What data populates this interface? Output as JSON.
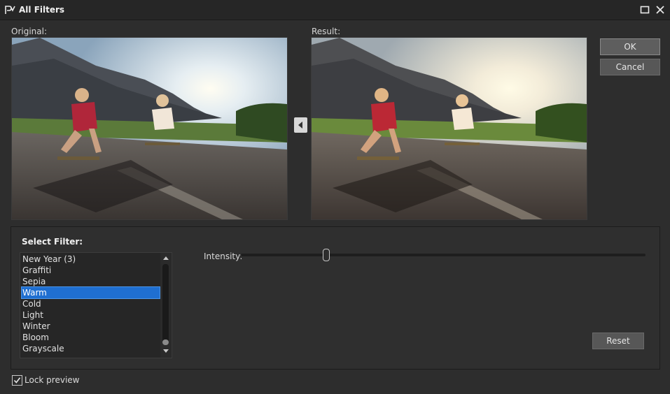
{
  "window": {
    "title": "All Filters",
    "icon": "app-logo-icon"
  },
  "preview": {
    "original_label": "Original:",
    "result_label": "Result:"
  },
  "buttons": {
    "ok": "OK",
    "cancel": "Cancel",
    "reset": "Reset"
  },
  "filter": {
    "select_label": "Select Filter:",
    "items": [
      "New Year (3)",
      "Graffiti",
      "Sepia",
      "Warm",
      "Cold",
      "Light",
      "Winter",
      "Bloom",
      "Grayscale"
    ],
    "selected": "Warm"
  },
  "intensity": {
    "label": "Intensity:",
    "value_fraction": 0.21
  },
  "lock_preview": {
    "label": "Lock preview",
    "checked": true
  },
  "colors": {
    "background": "#2d2d2d",
    "selection": "#1f6fd1",
    "button": "#575757"
  }
}
